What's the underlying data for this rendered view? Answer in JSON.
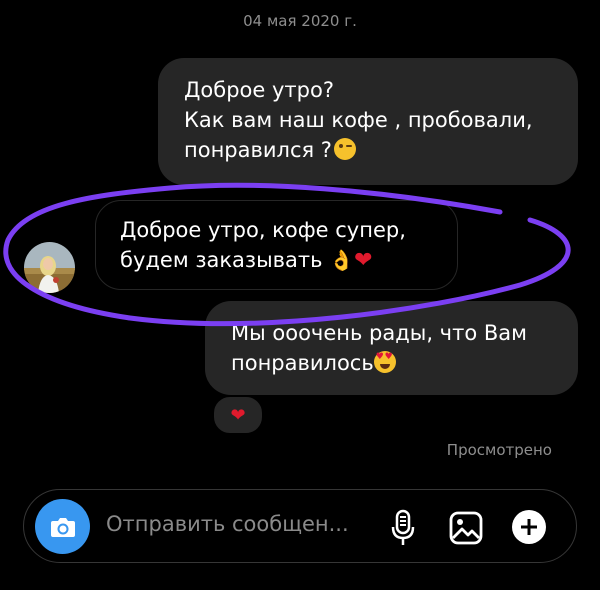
{
  "date_header": "04 мая 2020 г.",
  "messages": [
    {
      "direction": "outgoing",
      "lines": [
        "Доброе утро?",
        "Как вам наш кофе , пробовали,",
        "понравился ?"
      ],
      "emoji": "winking-face"
    },
    {
      "direction": "incoming",
      "lines": [
        "Доброе утро, кофе супер,",
        "будем заказывать"
      ],
      "emoji": "ok-hand red-heart"
    },
    {
      "direction": "outgoing",
      "lines": [
        "Мы ооочень рады, что Вам",
        "понравилось"
      ],
      "emoji": "heart-eyes-face",
      "reaction": "red-heart"
    }
  ],
  "status": "Просмотрено",
  "composer": {
    "placeholder": "Отправить сообщен...",
    "icons": [
      "camera-icon",
      "microphone-icon",
      "gallery-icon",
      "plus-icon"
    ]
  },
  "colors": {
    "background": "#000000",
    "bubble": "#262626",
    "accent_blue": "#3897f0",
    "annotation_purple": "#7b3ff2",
    "secondary_text": "#8e8e8e"
  }
}
